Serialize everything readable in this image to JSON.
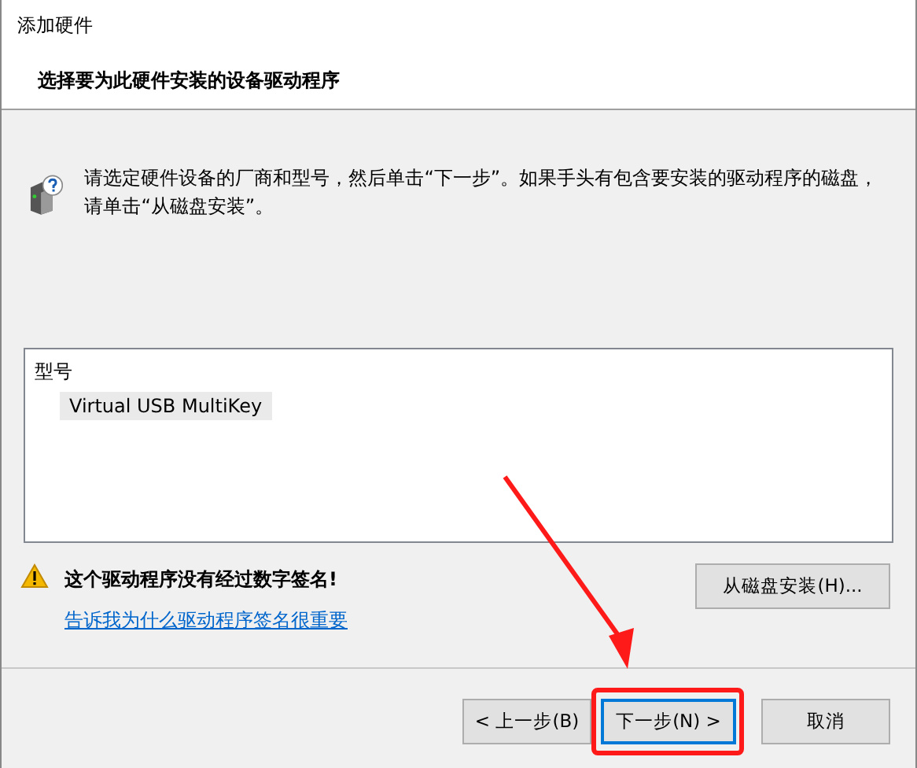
{
  "window": {
    "title": "添加硬件"
  },
  "header": {
    "heading": "选择要为此硬件安装的设备驱动程序"
  },
  "instruction": "请选定硬件设备的厂商和型号，然后单击“下一步”。如果手头有包含要安装的驱动程序的磁盘，请单击“从磁盘安装”。",
  "model_list": {
    "column": "型号",
    "items": [
      {
        "label": "Virtual USB MultiKey",
        "selected": true
      }
    ]
  },
  "warning": {
    "text": "这个驱动程序没有经过数字签名!",
    "link": "告诉我为什么驱动程序签名很重要"
  },
  "have_disk_button": "从磁盘安装(H)...",
  "buttons": [
    {
      "label": "< 上一步(B)",
      "default": false
    },
    {
      "label": "下一步(N) >",
      "default": true
    },
    {
      "label": "取消",
      "default": false
    }
  ]
}
